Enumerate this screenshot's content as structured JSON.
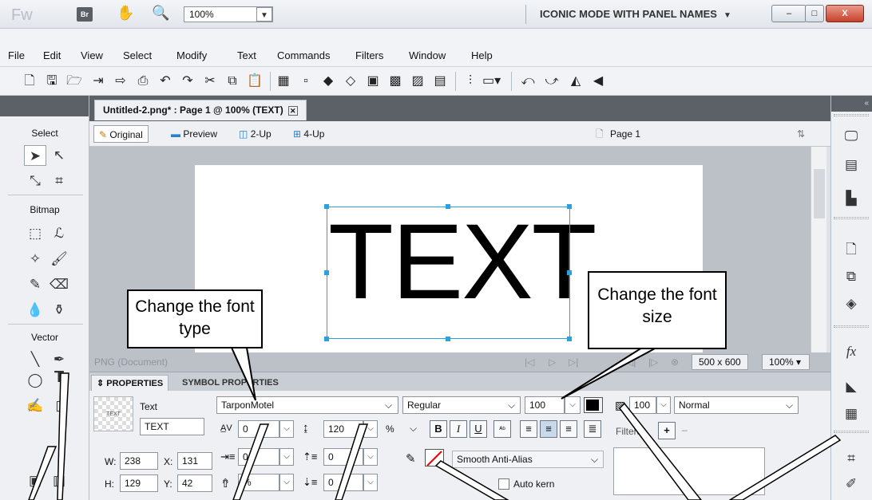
{
  "titlebar": {
    "logo": "Fw",
    "bridge_label": "Br",
    "zoom_value": "100%",
    "workspace": "ICONIC MODE WITH PANEL NAMES",
    "minimize": "–",
    "maximize": "□",
    "close": "X"
  },
  "menu": [
    "File",
    "Edit",
    "View",
    "Select",
    "Modify",
    "Text",
    "Commands",
    "Filters",
    "Window",
    "Help"
  ],
  "document": {
    "tab_title": "Untitled-2.png* : Page 1 @ 100% (TEXT)",
    "views": [
      "Original",
      "Preview",
      "2-Up",
      "4-Up"
    ],
    "page_label": "Page 1",
    "canvas_text": "TEXT",
    "status_left": "PNG (Document)",
    "canvas_size": "500 x 600",
    "zoom": "100%"
  },
  "tools": {
    "sections": [
      "Select",
      "Bitmap",
      "Vector"
    ]
  },
  "properties": {
    "tabs": [
      "PROPERTIES",
      "SYMBOL PROPERTIES"
    ],
    "thumb_label": "TEXT",
    "type_label": "Text",
    "name_value": "TEXT",
    "w_label": "W:",
    "w_value": "238",
    "x_label": "X:",
    "x_value": "131",
    "h_label": "H:",
    "h_value": "129",
    "y_label": "Y:",
    "y_value": "42",
    "font_family": "TarponMotel",
    "font_style": "Regular",
    "font_size": "100",
    "kerning": "0",
    "leading": "120",
    "leading_unit": "%",
    "indent": "0",
    "space_before": "0",
    "space_after": "0",
    "baseline_pct": "%",
    "anti_alias": "Smooth Anti-Alias",
    "auto_kern": "Auto kern",
    "opacity": "100",
    "blend_mode": "Normal",
    "filters_label": "Filters",
    "filter_add": "+",
    "filter_remove": "–",
    "bold": "B",
    "italic": "I",
    "underline": "U",
    "text_color": "#000000"
  },
  "callouts": {
    "font_type": "Change the font type",
    "font_size": "Change the font size"
  }
}
